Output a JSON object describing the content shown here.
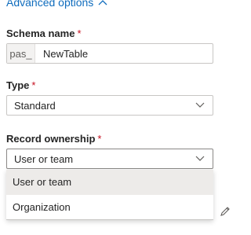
{
  "advanced": {
    "label": "Advanced options"
  },
  "schema": {
    "label": "Schema name",
    "required_mark": "*",
    "prefix": "pas_",
    "value": "NewTable"
  },
  "type": {
    "label": "Type",
    "required_mark": "*",
    "value": "Standard"
  },
  "ownership": {
    "label": "Record ownership",
    "required_mark": "*",
    "value": "User or team",
    "options": [
      "User or team",
      "Organization"
    ]
  },
  "icons": {
    "advanced_toggle": "chevron-up-icon",
    "select_arrow": "chevron-down-icon",
    "edit": "pencil-icon"
  },
  "colors": {
    "link": "#0f6cbd",
    "required": "#c50f1f",
    "selected_option_bg": "#edebe9"
  }
}
